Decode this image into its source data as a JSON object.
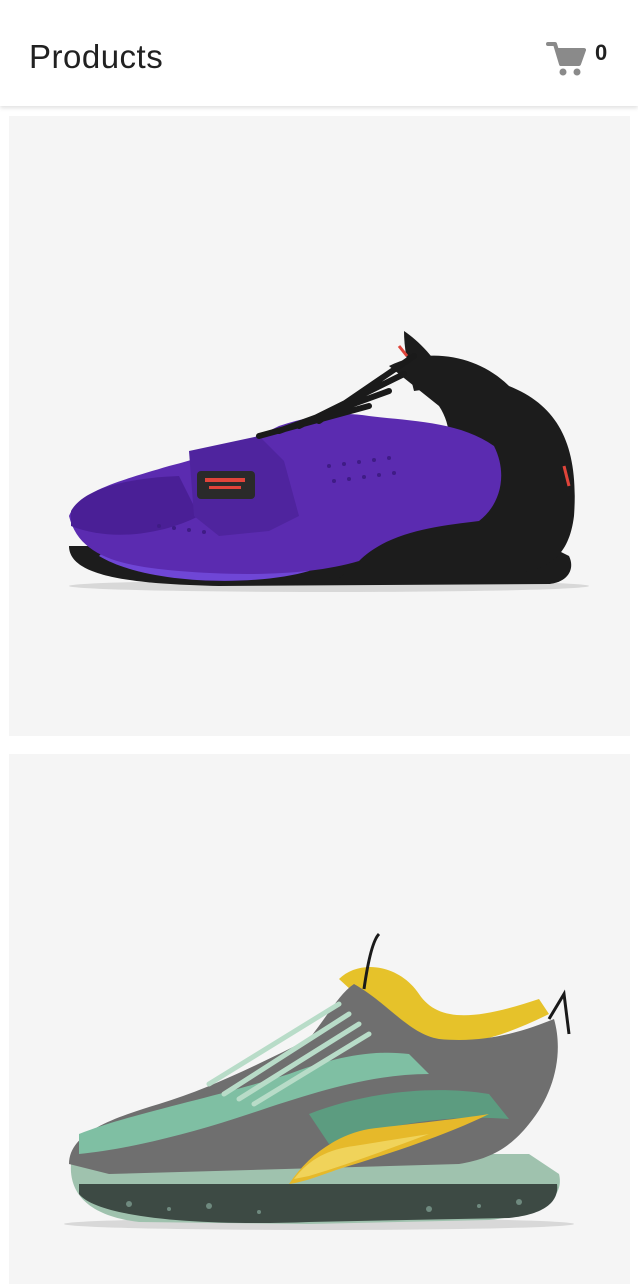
{
  "app_bar": {
    "title": "Products",
    "cart_icon": "shopping-cart-icon",
    "cart_count": "0"
  },
  "products": [
    {
      "image": "basketball-shoe-purple-black",
      "colors": {
        "upper": "#5b2bb0",
        "heel": "#1c1c1c",
        "accent": "#e0443a"
      }
    },
    {
      "image": "basketball-shoe-grey-green-yellow",
      "colors": {
        "upper": "#6f6f6f",
        "sole": "#9fc2ae",
        "accent": "#e6b92a"
      }
    }
  ],
  "colors": {
    "background": "#ffffff",
    "card": "#f5f5f5",
    "text": "#212121",
    "cart_icon": "#8a8a8a"
  }
}
